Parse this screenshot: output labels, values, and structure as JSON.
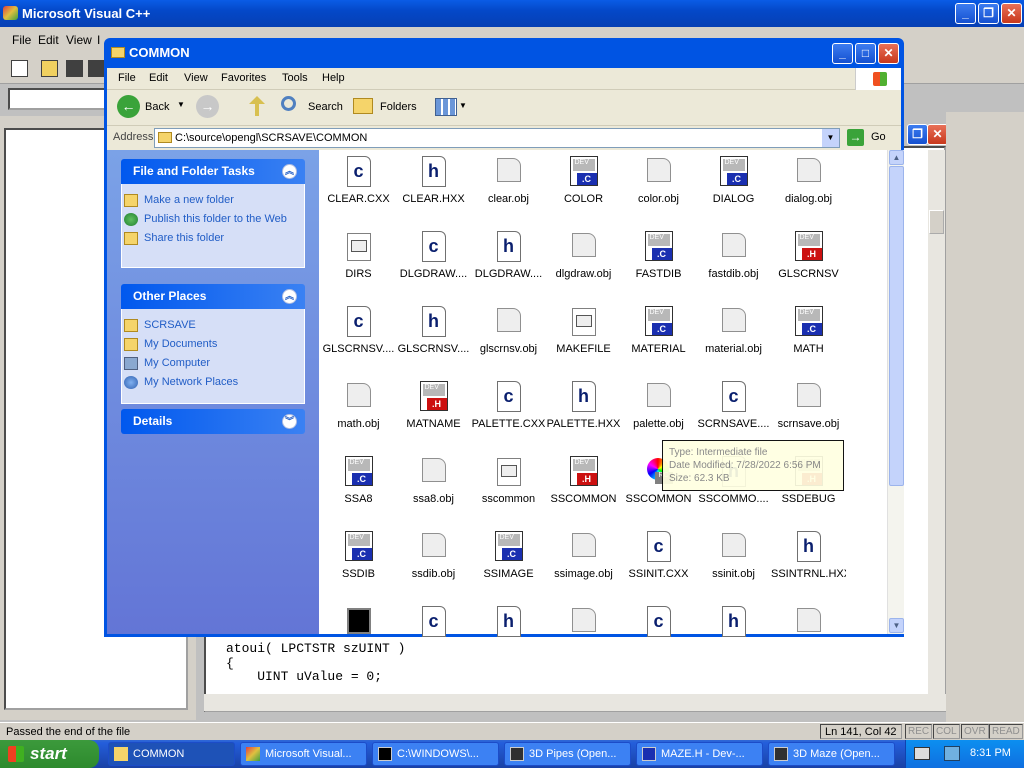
{
  "vc": {
    "title": "Microsoft Visual C++",
    "menu": [
      "File",
      "Edit",
      "View",
      "I"
    ],
    "code_lines": [
      "atoui( LPCTSTR szUINT )",
      "{",
      "    UINT uValue = 0;"
    ],
    "status_message": "Passed the end of the file",
    "status_position": "Ln 141, Col 42",
    "indicators": [
      "REC",
      "COL",
      "OVR",
      "READ"
    ]
  },
  "explorer": {
    "title": "COMMON",
    "menu": [
      "File",
      "Edit",
      "View",
      "Favorites",
      "Tools",
      "Help"
    ],
    "toolbar": {
      "back": "Back",
      "search": "Search",
      "folders": "Folders"
    },
    "address_label": "Address",
    "address_value": "C:\\source\\opengl\\SCRSAVE\\COMMON",
    "go_label": "Go",
    "tasks": {
      "file_folder": {
        "title": "File and Folder Tasks",
        "links": [
          "Make a new folder",
          "Publish this folder to the Web",
          "Share this folder"
        ]
      },
      "other_places": {
        "title": "Other Places",
        "links": [
          "SCRSAVE",
          "My Documents",
          "My Computer",
          "My Network Places"
        ]
      },
      "details": {
        "title": "Details"
      }
    },
    "files": [
      {
        "name": "CLEAR.CXX",
        "kind": "c"
      },
      {
        "name": "CLEAR.HXX",
        "kind": "h"
      },
      {
        "name": "clear.obj",
        "kind": "obj"
      },
      {
        "name": "COLOR",
        "kind": "devc"
      },
      {
        "name": "color.obj",
        "kind": "obj"
      },
      {
        "name": "DIALOG",
        "kind": "devc"
      },
      {
        "name": "dialog.obj",
        "kind": "obj"
      },
      {
        "name": "DIRS",
        "kind": "mk"
      },
      {
        "name": "DLGDRAW....",
        "kind": "c"
      },
      {
        "name": "DLGDRAW....",
        "kind": "h"
      },
      {
        "name": "dlgdraw.obj",
        "kind": "obj"
      },
      {
        "name": "FASTDIB",
        "kind": "devc"
      },
      {
        "name": "fastdib.obj",
        "kind": "obj"
      },
      {
        "name": "GLSCRNSV",
        "kind": "devh"
      },
      {
        "name": "GLSCRNSV....",
        "kind": "c"
      },
      {
        "name": "GLSCRNSV....",
        "kind": "h"
      },
      {
        "name": "glscrnsv.obj",
        "kind": "obj"
      },
      {
        "name": "MAKEFILE",
        "kind": "mk"
      },
      {
        "name": "MATERIAL",
        "kind": "devc"
      },
      {
        "name": "material.obj",
        "kind": "obj"
      },
      {
        "name": "MATH",
        "kind": "devc"
      },
      {
        "name": "math.obj",
        "kind": "obj"
      },
      {
        "name": "MATNAME",
        "kind": "devh"
      },
      {
        "name": "PALETTE.CXX",
        "kind": "c"
      },
      {
        "name": "PALETTE.HXX",
        "kind": "h"
      },
      {
        "name": "palette.obj",
        "kind": "obj"
      },
      {
        "name": "SCRNSAVE....",
        "kind": "c"
      },
      {
        "name": "scrnsave.obj",
        "kind": "obj"
      },
      {
        "name": "SSA8",
        "kind": "devc"
      },
      {
        "name": "ssa8.obj",
        "kind": "obj"
      },
      {
        "name": "sscommon",
        "kind": "mk"
      },
      {
        "name": "SSCOMMON",
        "kind": "devh"
      },
      {
        "name": "SSCOMMON",
        "kind": "rc"
      },
      {
        "name": "SSCOMMO....",
        "kind": "h"
      },
      {
        "name": "SSDEBUG",
        "kind": "devh"
      },
      {
        "name": "SSDIB",
        "kind": "devc"
      },
      {
        "name": "ssdib.obj",
        "kind": "obj"
      },
      {
        "name": "SSIMAGE",
        "kind": "devc"
      },
      {
        "name": "ssimage.obj",
        "kind": "obj"
      },
      {
        "name": "SSINIT.CXX",
        "kind": "c"
      },
      {
        "name": "ssinit.obj",
        "kind": "obj"
      },
      {
        "name": "SSINTRNL.HXX",
        "kind": "h"
      },
      {
        "name": "",
        "kind": "exe"
      },
      {
        "name": "",
        "kind": "c"
      },
      {
        "name": "",
        "kind": "h"
      },
      {
        "name": "",
        "kind": "obj"
      },
      {
        "name": "",
        "kind": "c"
      },
      {
        "name": "",
        "kind": "h"
      },
      {
        "name": "",
        "kind": "obj"
      }
    ],
    "tooltip": [
      "Type: Intermediate file",
      "Date Modified: 7/28/2022 6:56 PM",
      "Size: 62.3 KB"
    ]
  },
  "taskbar": {
    "start": "start",
    "buttons": [
      "COMMON",
      "Microsoft Visual...",
      "C:\\WINDOWS\\...",
      "3D Pipes (Open...",
      "MAZE.H - Dev-...",
      "3D Maze (Open..."
    ],
    "clock": "8:31 PM"
  },
  "colors": {
    "xp_blue": "#0054e3",
    "task_pane": "#6375d6",
    "dev_c": "#1a2fb0",
    "dev_h": "#cc1010"
  }
}
